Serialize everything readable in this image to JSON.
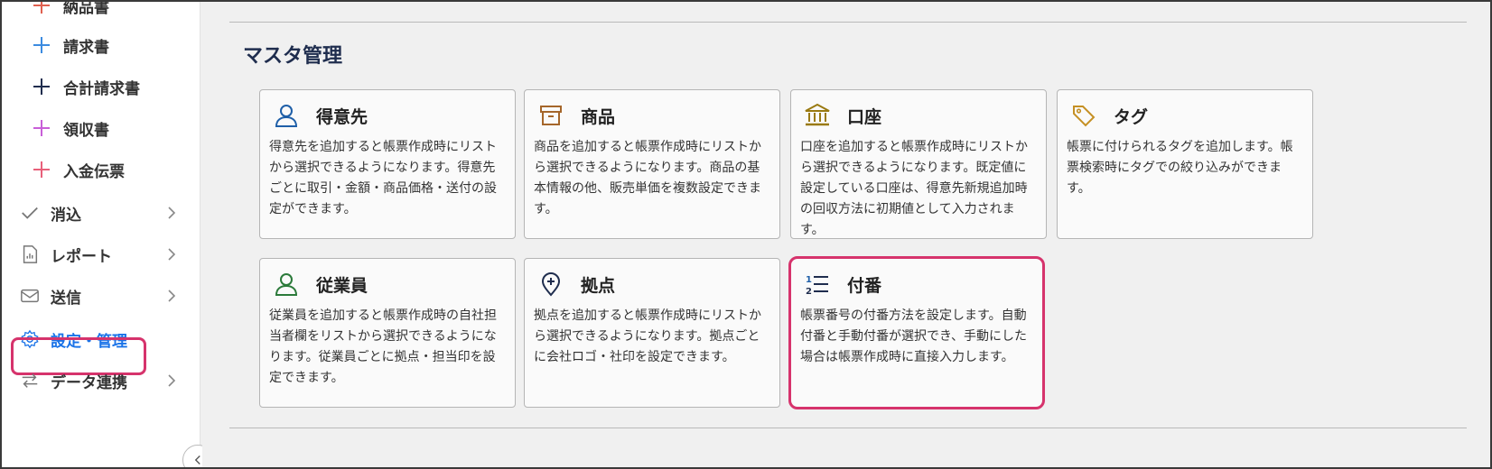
{
  "sidebar": {
    "sub_items": [
      {
        "label": "納品書",
        "color": "#e0604f"
      },
      {
        "label": "請求書",
        "color": "#3c8be0"
      },
      {
        "label": "合計請求書",
        "color": "#1f2d4e"
      },
      {
        "label": "領収書",
        "color": "#c85fd8"
      },
      {
        "label": "入金伝票",
        "color": "#e8607a"
      }
    ],
    "top_items": [
      {
        "label": "消込",
        "icon": "check-icon"
      },
      {
        "label": "レポート",
        "icon": "report-icon"
      },
      {
        "label": "送信",
        "icon": "mail-icon"
      },
      {
        "label": "設定・管理",
        "icon": "gear-icon",
        "active": true
      },
      {
        "label": "データ連携",
        "icon": "sync-icon"
      }
    ],
    "active_color": "#1a73e8"
  },
  "main": {
    "section_title": "マスタ管理",
    "cards": [
      {
        "title": "得意先",
        "icon": "person-icon",
        "icon_color": "#1f5fa8",
        "desc": "得意先を追加すると帳票作成時にリストから選択できるようになります。得意先ごとに取引・金額・商品価格・送付の設定ができます。"
      },
      {
        "title": "商品",
        "icon": "box-icon",
        "icon_color": "#a5662a",
        "desc": "商品を追加すると帳票作成時にリストから選択できるようになります。商品の基本情報の他、販売単価を複数設定できます。"
      },
      {
        "title": "口座",
        "icon": "bank-icon",
        "icon_color": "#9a7a12",
        "desc": "口座を追加すると帳票作成時にリストから選択できるようになります。既定値に設定している口座は、得意先新規追加時の回収方法に初期値として入力されます。"
      },
      {
        "title": "タグ",
        "icon": "tag-icon",
        "icon_color": "#c59024",
        "desc": "帳票に付けられるタグを追加します。帳票検索時にタグでの絞り込みができます。"
      },
      {
        "title": "従業員",
        "icon": "employee-icon",
        "icon_color": "#2b7a3a",
        "desc": "従業員を追加すると帳票作成時の自社担当者欄をリストから選択できるようになります。従業員ごとに拠点・担当印を設定できます。"
      },
      {
        "title": "拠点",
        "icon": "location-icon",
        "icon_color": "#1f2d4e",
        "desc": "拠点を追加すると帳票作成時にリストから選択できるようになります。拠点ごとに会社ロゴ・社印を設定できます。"
      },
      {
        "title": "付番",
        "icon": "numbering-icon",
        "icon_color": "#1f2d4e",
        "desc": "帳票番号の付番方法を設定します。自動付番と手動付番が選択でき、手動にした場合は帳票作成時に直接入力します。",
        "highlighted": true
      }
    ]
  },
  "highlight_color": "#d6336c"
}
